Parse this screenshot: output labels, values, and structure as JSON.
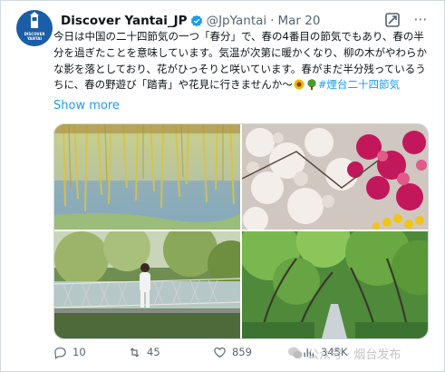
{
  "tweet": {
    "author_name": "Discover Yantai_JP",
    "handle": "@JpYantai",
    "separator": "·",
    "date": "Mar 20",
    "avatar_text_line1": "DISCOVER",
    "avatar_text_line2": "YANTAI",
    "text_before": "今日は中国の二十四節気の一つ「春分」で、春の4番目の節気でもあり、春の半分を過ぎたことを意味しています。気温が次第に暖かくなり、柳の木がやわらかな影を落としており、花がひっそりと咲いています。春がまだ半分残っているうちに、春の野遊び「踏青」や花見に行きませんか～",
    "hashtag": "#煙台二十四節気",
    "show_more": "Show more"
  },
  "media": {
    "images": [
      {
        "name": "willow-photo"
      },
      {
        "name": "blossom-photo"
      },
      {
        "name": "bridge-photo"
      },
      {
        "name": "tree-path-photo"
      }
    ]
  },
  "actions": {
    "replies": "10",
    "reposts": "45",
    "likes": "859",
    "views": "345K"
  },
  "watermark": {
    "text": "公众号 · 烟台发布"
  },
  "colors": {
    "link": "#1d9bf0",
    "text": "#0f1419",
    "secondary": "#536471",
    "verified": "#1d9bf0"
  },
  "icons": [
    "verified-badge-icon",
    "grok-icon",
    "more-options-icon",
    "reply-icon",
    "repost-icon",
    "like-icon",
    "views-icon",
    "sunflower-emoji",
    "tree-emoji"
  ]
}
